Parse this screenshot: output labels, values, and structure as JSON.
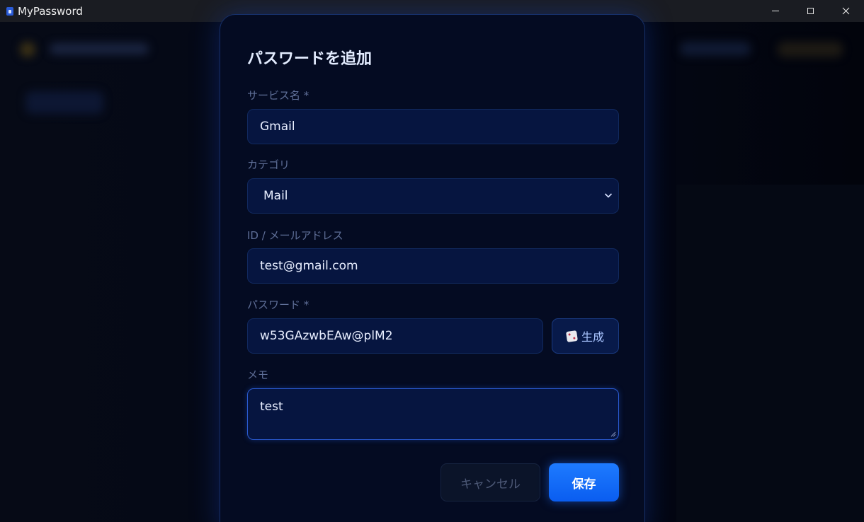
{
  "window": {
    "title": "MyPassword"
  },
  "modal": {
    "title": "パスワードを追加",
    "service": {
      "label": "サービス名 *",
      "value": "Gmail"
    },
    "category": {
      "label": "カテゴリ",
      "value": "Mail"
    },
    "account": {
      "label": "ID / メールアドレス",
      "value": "test@gmail.com"
    },
    "password": {
      "label": "パスワード *",
      "value": "w53GAzwbEAw@plM2",
      "generate_label": "生成"
    },
    "memo": {
      "label": "メモ",
      "value": "test"
    },
    "cancel_label": "キャンセル",
    "save_label": "保存"
  },
  "colors": {
    "accent": "#1e7bff",
    "background": "#040b22"
  }
}
